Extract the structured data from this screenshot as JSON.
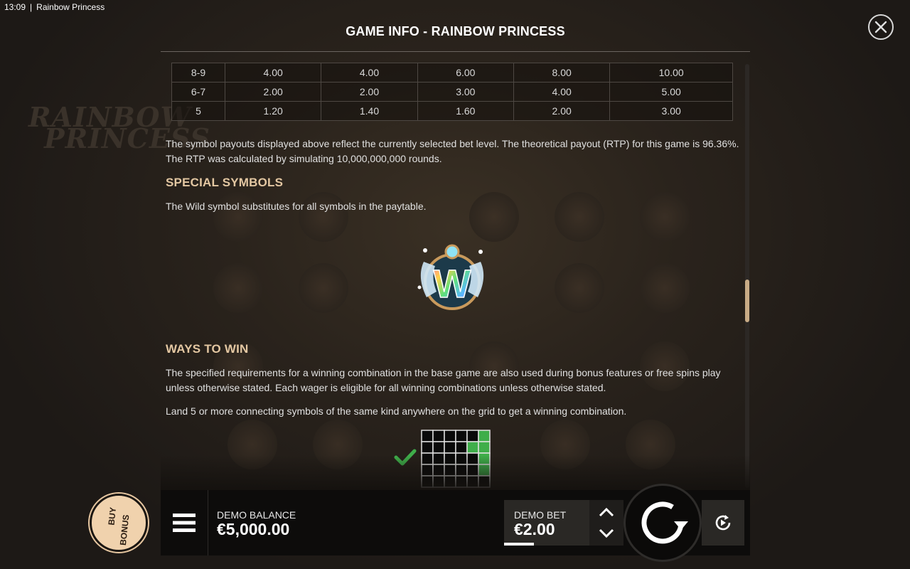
{
  "status_bar": {
    "time": "13:09",
    "app_name": "Rainbow Princess"
  },
  "background": {
    "logo_text_line1": "RAINBOW",
    "logo_text_line2": "PRINCESS"
  },
  "header": {
    "title": "GAME INFO - RAINBOW PRINCESS",
    "close_icon": "close-icon"
  },
  "paytable": {
    "rows": [
      {
        "count": "8-9",
        "values": [
          "4.00",
          "4.00",
          "6.00",
          "8.00",
          "10.00"
        ]
      },
      {
        "count": "6-7",
        "values": [
          "2.00",
          "2.00",
          "3.00",
          "4.00",
          "5.00"
        ]
      },
      {
        "count": "5",
        "values": [
          "1.20",
          "1.40",
          "1.60",
          "2.00",
          "3.00"
        ]
      }
    ]
  },
  "content": {
    "rtp_text": "The symbol payouts displayed above reflect the currently selected bet level. The theoretical payout (RTP) for this game is 96.36%. The RTP was calculated by simulating 10,000,000,000 rounds.",
    "special_heading": "SPECIAL SYMBOLS",
    "wild_text": "The Wild symbol substitutes for all symbols in the paytable.",
    "wild_letter": "W",
    "ways_heading": "WAYS TO WIN",
    "ways_text_1": "The specified requirements for a winning combination in the base game are also used during bonus features or free spins play unless otherwise stated. Each wager is eligible for all winning combinations unless otherwise stated.",
    "ways_text_2": "Land 5 or more connecting symbols of the same kind anywhere on the grid to get a winning combination."
  },
  "bottom_bar": {
    "buy_bonus_line1": "BUY",
    "buy_bonus_line2": "BONUS",
    "balance_label": "DEMO BALANCE",
    "balance_value": "€5,000.00",
    "bet_label": "DEMO BET",
    "bet_value": "€2.00"
  },
  "colors": {
    "accent_heading": "#e3c7a2",
    "win_green": "#3fae4a",
    "buy_bonus_bg": "#f0d2ad"
  },
  "icons": [
    "close-icon",
    "menu-icon",
    "chevron-up-icon",
    "chevron-down-icon",
    "spin-icon",
    "autoplay-icon",
    "checkmark-icon",
    "wild-symbol-icon"
  ]
}
